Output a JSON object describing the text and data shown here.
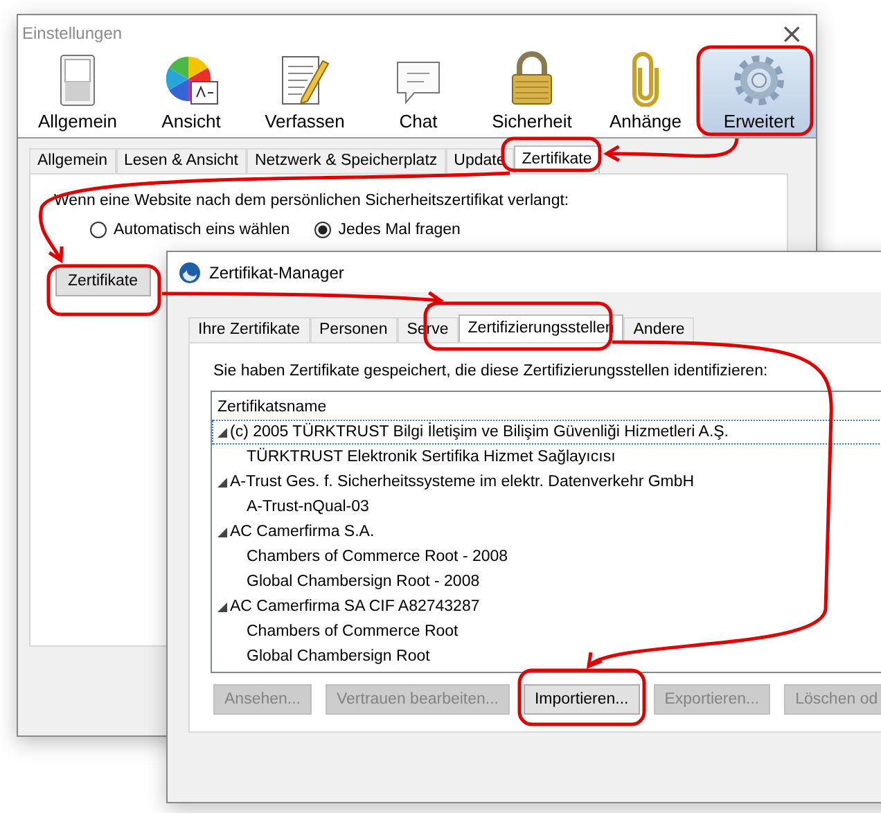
{
  "settings_window": {
    "title": "Einstellungen",
    "close": "×",
    "toolbar": [
      {
        "label": "Allgemein",
        "selected": false
      },
      {
        "label": "Ansicht",
        "selected": false
      },
      {
        "label": "Verfassen",
        "selected": false
      },
      {
        "label": "Chat",
        "selected": false
      },
      {
        "label": "Sicherheit",
        "selected": false
      },
      {
        "label": "Anhänge",
        "selected": false
      },
      {
        "label": "Erweitert",
        "selected": true
      }
    ],
    "tabs": [
      {
        "label": "Allgemein",
        "selected": false
      },
      {
        "label": "Lesen & Ansicht",
        "selected": false
      },
      {
        "label": "Netzwerk & Speicherplatz",
        "selected": false
      },
      {
        "label": "Update",
        "selected": false
      },
      {
        "label": "Zertifikate",
        "selected": true
      }
    ],
    "prompt": "Wenn eine Website nach dem persönlichen Sicherheitszertifikat verlangt:",
    "radios": [
      {
        "label": "Automatisch eins wählen",
        "selected": false
      },
      {
        "label": "Jedes Mal fragen",
        "selected": true
      }
    ],
    "certificates_button": "Zertifikate"
  },
  "certificate_manager": {
    "title": "Zertifikat-Manager",
    "tabs": [
      {
        "label": "Ihre Zertifikate",
        "selected": false
      },
      {
        "label": "Personen",
        "selected": false
      },
      {
        "label": "Serve",
        "selected": false
      },
      {
        "label": "Zertifizierungsstellen",
        "selected": true
      },
      {
        "label": "Andere",
        "selected": false
      }
    ],
    "intro": "Sie haben Zertifikate gespeichert, die diese Zertifizierungsstellen identifizieren:",
    "column": "Zertifikatsname",
    "tree": [
      {
        "name": "(c) 2005 TÜRKTRUST Bilgi İletişim ve Bilişim Güvenliği Hizmetleri A.Ş.",
        "expanded": true,
        "focused": true,
        "children": [
          {
            "name": "TÜRKTRUST Elektronik Sertifika Hizmet Sağlayıcısı"
          }
        ]
      },
      {
        "name": "A-Trust Ges. f. Sicherheitssysteme im elektr. Datenverkehr GmbH",
        "expanded": true,
        "focused": false,
        "children": [
          {
            "name": "A-Trust-nQual-03"
          }
        ]
      },
      {
        "name": "AC Camerfirma S.A.",
        "expanded": true,
        "focused": false,
        "children": [
          {
            "name": "Chambers of Commerce Root - 2008"
          },
          {
            "name": "Global Chambersign Root - 2008"
          }
        ]
      },
      {
        "name": "AC Camerfirma SA CIF A82743287",
        "expanded": true,
        "focused": false,
        "children": [
          {
            "name": "Chambers of Commerce Root"
          },
          {
            "name": "Global Chambersign Root"
          }
        ]
      }
    ],
    "buttons": [
      {
        "label": "Ansehen...",
        "disabled": true
      },
      {
        "label": "Vertrauen bearbeiten...",
        "disabled": true
      },
      {
        "label": "Importieren...",
        "disabled": false
      },
      {
        "label": "Exportieren...",
        "disabled": true
      },
      {
        "label": "Löschen od",
        "disabled": true
      }
    ]
  }
}
